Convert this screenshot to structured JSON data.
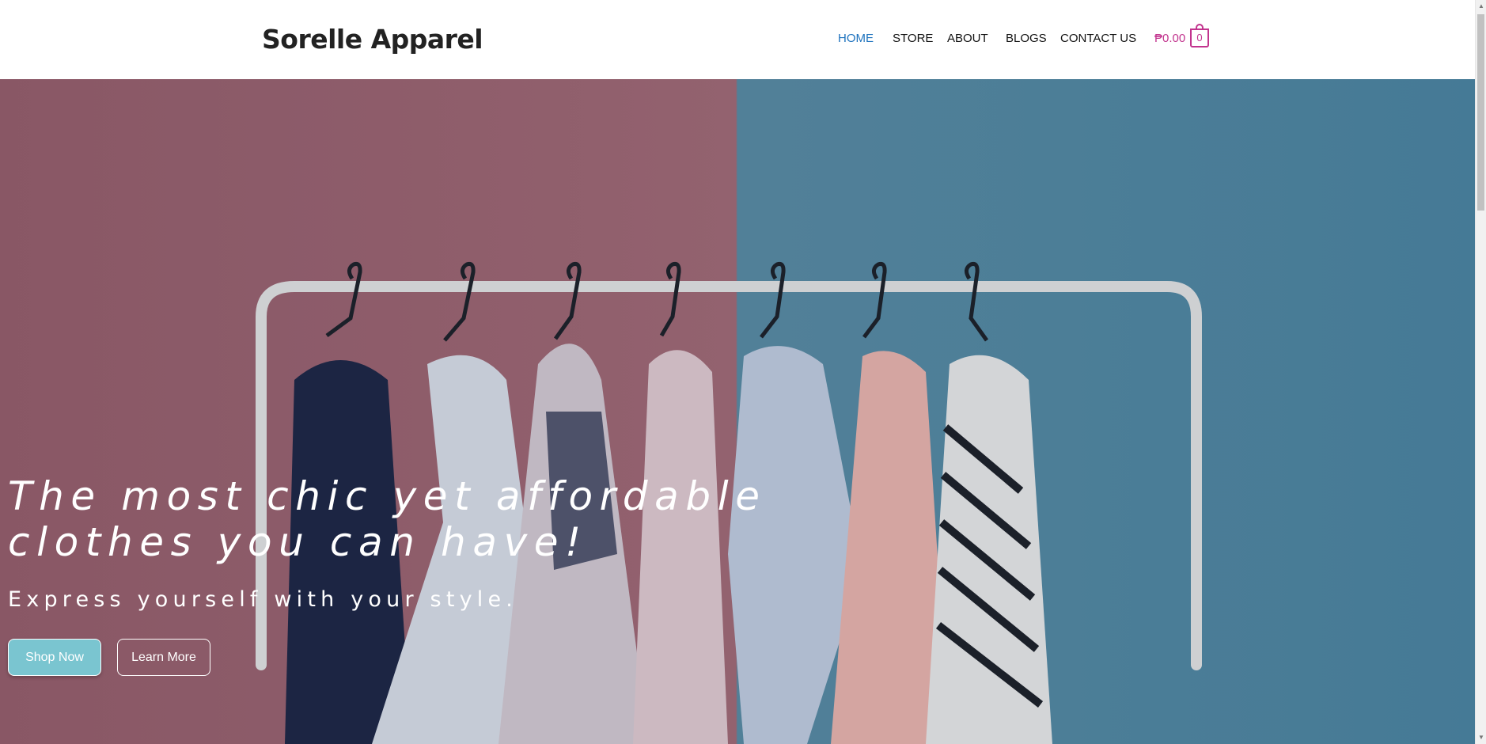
{
  "header": {
    "brand": "Sorelle Apparel",
    "nav": [
      {
        "label": "HOME",
        "active": true
      },
      {
        "label": "STORE",
        "active": false
      },
      {
        "label": "ABOUT",
        "active": false
      },
      {
        "label": "BLOGS",
        "active": false
      },
      {
        "label": "CONTACT US",
        "active": false
      }
    ],
    "cart": {
      "total": "₱0.00",
      "count": "0",
      "icon": "shopping-bag-icon"
    }
  },
  "hero": {
    "title": "The most chic yet affordable clothes you can have!",
    "subtitle": "Express yourself with your style.",
    "primary_button": "Shop Now",
    "secondary_button": "Learn More",
    "background": {
      "left_wall": "#a56b79",
      "right_wall": "#4d87a6"
    }
  },
  "colors": {
    "nav_active": "#1e73be",
    "cart_accent": "#c2348e",
    "shop_button": "#7ac5d0"
  },
  "scrollbar": {
    "up_icon": "scroll-up-arrow-icon",
    "down_icon": "scroll-down-arrow-icon"
  }
}
